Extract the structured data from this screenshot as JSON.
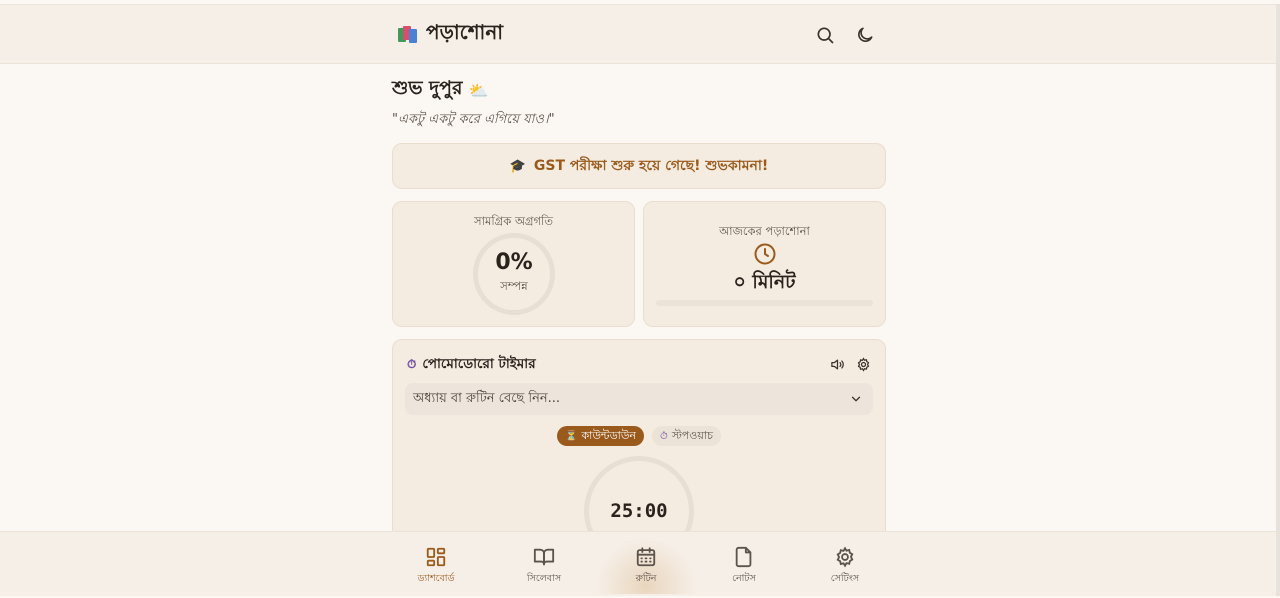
{
  "app": {
    "title": "পড়াশোনা"
  },
  "header": {
    "search_icon": "search-icon",
    "theme_icon": "moon-icon"
  },
  "greeting": {
    "text": "শুভ দুপুর",
    "emoji": "⛅"
  },
  "quote": "\"একটু একটু করে এগিয়ে যাও।\"",
  "banner": {
    "emoji": "🎓",
    "text": "GST পরীক্ষা শুরু হয়ে গেছে! শুভকামনা!"
  },
  "stats": {
    "progress": {
      "label": "সামগ্রিক অগ্রগতি",
      "value": "0%",
      "sub": "সম্পন্ন",
      "fraction": 0
    },
    "today": {
      "label": "আজকের পড়াশোনা",
      "value": "০ মিনিট",
      "fraction": 0
    }
  },
  "pomodoro": {
    "emoji": "⏱",
    "title": "পোমোডোরো টাইমার",
    "select_placeholder": "অধ্যায় বা রুটিন বেছে নিন...",
    "modes": [
      {
        "emoji": "⏳",
        "label": "কাউন্টডাউন",
        "active": true
      },
      {
        "emoji": "⏱",
        "label": "স্টপওয়াচ",
        "active": false
      }
    ],
    "time": "25:00"
  },
  "nav": [
    {
      "label": "ড্যাশবোর্ড",
      "icon": "dashboard-icon",
      "active": true
    },
    {
      "label": "সিলেবাস",
      "icon": "book-icon",
      "active": false
    },
    {
      "label": "রুটিন",
      "icon": "calendar-icon",
      "active": false
    },
    {
      "label": "নোটস",
      "icon": "note-icon",
      "active": false
    },
    {
      "label": "সেটিংস",
      "icon": "gear-icon",
      "active": false
    }
  ],
  "colors": {
    "accent": "#9a5a1c",
    "background": "#fbf8f3",
    "card": "#f5ece1"
  }
}
